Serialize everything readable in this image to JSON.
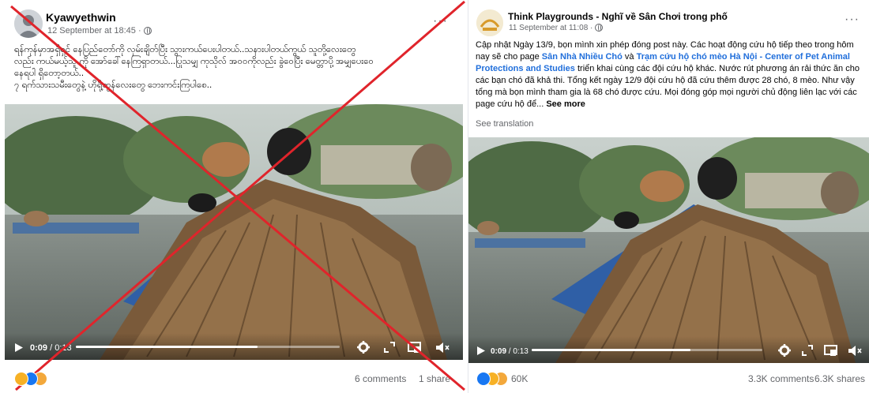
{
  "left_post": {
    "author": "Kyawyethwin",
    "date": "12 September at 18:45 ·",
    "more": "···",
    "text_lines": [
      "ရန်ကုန်မှာအရှိရှင် နေပြည်တော်ကို လှမ်းချိတ်ပြီး သွားကယ်ပေးပါတယ်..သနားပါတယ်ကွယ် သူတို့လေးတွေ",
      "လည်း ကယ်မယ့်သူ ကို အော်ခေါ်နေကြရှာတယ်...ပြုသမျှ ကုသိုလ် အဝဝကိုလည်း ခွဲဝေပြီး မေတ္တာပို့ အမျှပေးဝေ",
      "နေရပါ ရှိတော့တယ်..",
      "၇ ရက်သားသမီးတွေနဲ့ ဟိုရို့ဆွန်လေးတွေ ဘေးကင်းကြပါစေ.."
    ],
    "video": {
      "current": "0:09",
      "sep": "/",
      "total": "0:13",
      "progress": 0.69
    },
    "reactions": [
      "haha",
      "like",
      "care"
    ],
    "comments": "6 comments",
    "shares": "1 share"
  },
  "right_post": {
    "author": "Think Playgrounds - Nghĩ về Sân Chơi trong phố",
    "date": "11 September at 11:08 ·",
    "more": "···",
    "text": {
      "p1": "Cập nhật Ngày 13/9, bọn mình xin phép đóng post này. Các hoạt động cứu hộ tiếp theo trong hôm nay sẽ cho page ",
      "link1": "Sân Nhà Nhiều Chó",
      "and": " và ",
      "link2": "Trạm cứu hộ chó mèo Hà Nội - Center of Pet Animal Protections and Studies",
      "p2": " triển khai cùng các đội cứu hộ khác. Nước rút phương án rải thức ăn cho các bạn chó đã khả thi. Tổng kết ngày 12/9 đội cứu hộ đã cứu thêm được 28 chó, 8 mèo. Như vậy tổng mà bọn mình tham gia là 68 chó được cứu. Mọi đóng góp mọi người chủ động liên lạc với các page cứu hộ để...",
      "see_more": "See more"
    },
    "see_translation": "See translation",
    "video": {
      "current": "0:09",
      "sep": "/",
      "total": "0:13",
      "progress": 0.69
    },
    "reactions": [
      "like",
      "haha",
      "care"
    ],
    "reaction_count": "60K",
    "comments": "3.3K comments",
    "shares": "6.3K shares"
  },
  "colors": {
    "link": "#216fdb",
    "muted": "#65676b",
    "cross": "#e0242b",
    "like": "#1877f2",
    "haha": "#f7b125"
  },
  "icons": [
    "play-icon",
    "settings-icon",
    "fullscreen-icon",
    "pip-icon",
    "mute-icon",
    "globe-icon",
    "more-icon"
  ]
}
